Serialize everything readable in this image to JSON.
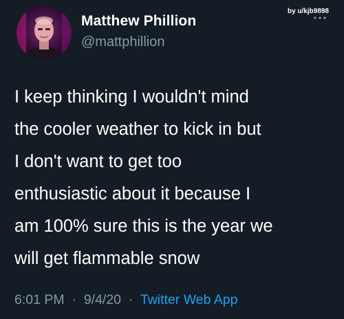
{
  "author": {
    "display_name": "Matthew Phillion",
    "handle": "@mattphillion"
  },
  "watermark": "by u/kjb9898",
  "tweet": {
    "lines": [
      "I keep thinking I wouldn't mind",
      "the cooler weather to kick in but",
      "I don't want to get too",
      "enthusiastic about it because I",
      "am 100% sure this is the year we",
      "will get flammable snow"
    ]
  },
  "meta": {
    "time": "6:01 PM",
    "separator": "·",
    "date": "9/4/20",
    "source": "Twitter Web App"
  },
  "colors": {
    "background": "#141d26",
    "secondary_text": "#8899a6",
    "link": "#1da1f2",
    "avatar_glow": "#d81b8a"
  },
  "icons": {
    "more": "more-dots-icon"
  }
}
